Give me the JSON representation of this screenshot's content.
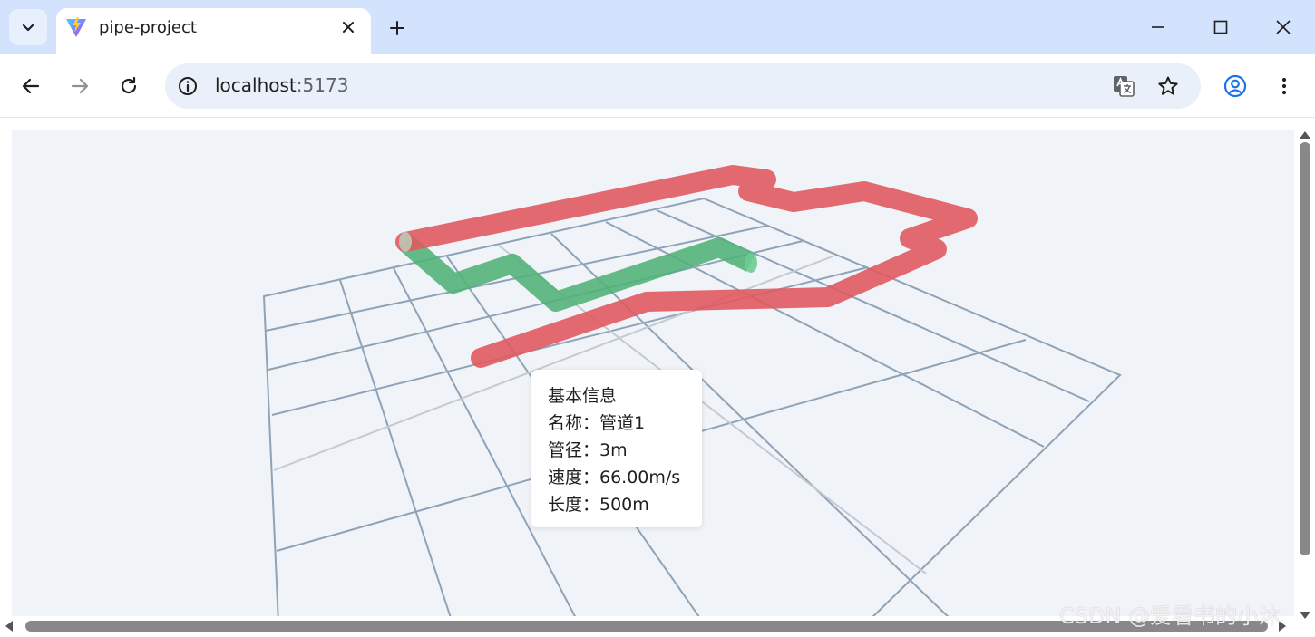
{
  "browser": {
    "tab": {
      "title": "pipe-project"
    },
    "address": {
      "host": "localhost",
      "port": ":5173"
    }
  },
  "tooltip": {
    "heading": "基本信息",
    "name": "名称：管道1",
    "diameter": "管径：3m",
    "speed": "速度：66.00m/s",
    "length": "长度：500m"
  },
  "pipes": [
    {
      "color": "#e05a5f"
    },
    {
      "color": "#4fb276"
    }
  ],
  "watermark": "CSDN @爱看书的小沐"
}
